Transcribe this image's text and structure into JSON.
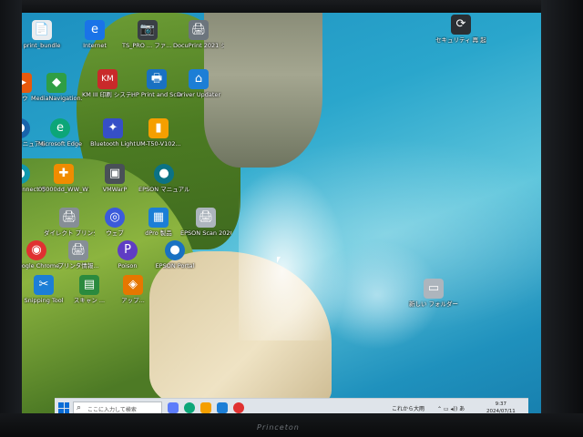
{
  "desktop": {
    "icons": [
      {
        "label": "print_bundle",
        "glyph": "📄",
        "color": "#e9ecef"
      },
      {
        "label": "Internet",
        "glyph": "e",
        "color": "#1a73e8"
      },
      {
        "label": "TS_PRO ... ファ... カット",
        "glyph": "📷",
        "color": "#3a3f45"
      },
      {
        "label": "DocuPrint 2021 シ... カット",
        "glyph": "🖨",
        "color": "#6c757d"
      },
      {
        "label": "セキュリティ 再 起動",
        "glyph": "⟳",
        "color": "#2b2f33"
      },
      {
        "label": "ソウ",
        "glyph": "▶",
        "color": "#e8590c"
      },
      {
        "label": "MediaNavigation...",
        "glyph": "◆",
        "color": "#2f9e44"
      },
      {
        "label": "KM III 印刷 システム",
        "glyph": "KM",
        "color": "#c92a2a"
      },
      {
        "label": "HP Print and Scan Doctor",
        "glyph": "🖶",
        "color": "#1971c2"
      },
      {
        "label": "Driver Updater",
        "glyph": "⌂",
        "color": "#1c7ed6"
      },
      {
        "label": "EPSON マニュアル",
        "glyph": "●",
        "color": "#1864ab"
      },
      {
        "label": "Microsoft Edge",
        "glyph": "e",
        "color": "#0ca678"
      },
      {
        "label": "Bluetooth Light",
        "glyph": "✦",
        "color": "#364fc7"
      },
      {
        "label": "UM-T50-V102...",
        "glyph": "▮",
        "color": "#f59f00"
      },
      {
        "label": "Epson Connect サイト",
        "glyph": "●",
        "color": "#1098ad"
      },
      {
        "label": "05000dd_WW_W10",
        "glyph": "✚",
        "color": "#f08c00"
      },
      {
        "label": "VMWarP",
        "glyph": "▣",
        "color": "#495057"
      },
      {
        "label": "EPSON マニュアル",
        "glyph": "●",
        "color": "#0b7285"
      },
      {
        "label": "ダイレクト プリンタ",
        "glyph": "🖨",
        "color": "#868e96"
      },
      {
        "label": "ウェブ",
        "glyph": "◎",
        "color": "#3b5bdb"
      },
      {
        "label": "dPro 製品",
        "glyph": "▦",
        "color": "#1c7ed6"
      },
      {
        "label": "EPSON Scan 2020 Utility",
        "glyph": "🖨",
        "color": "#adb5bd"
      },
      {
        "label": "Google Chrome",
        "glyph": "◉",
        "color": "#e03131"
      },
      {
        "label": "プリンタ情報...",
        "glyph": "🖨",
        "color": "#868e96"
      },
      {
        "label": "Poison",
        "glyph": "P",
        "color": "#5f3dc4"
      },
      {
        "label": "EPSON Portal",
        "glyph": "●",
        "color": "#1971c2"
      },
      {
        "label": "Snipping Tool",
        "glyph": "✂",
        "color": "#1c7ed6"
      },
      {
        "label": "スキャン ...",
        "glyph": "▤",
        "color": "#2b8a3e"
      },
      {
        "label": "アップ...",
        "glyph": "◈",
        "color": "#e67700"
      },
      {
        "label": "新しい フォルダー",
        "glyph": "▭",
        "color": "#adb5bd"
      }
    ]
  },
  "taskbar": {
    "search_placeholder": "ここに入力して検索",
    "tray_weather": "これから大雨",
    "clock_time": "9:37",
    "clock_date": "2024/07/11"
  },
  "monitor": {
    "brand": "Princeton"
  }
}
